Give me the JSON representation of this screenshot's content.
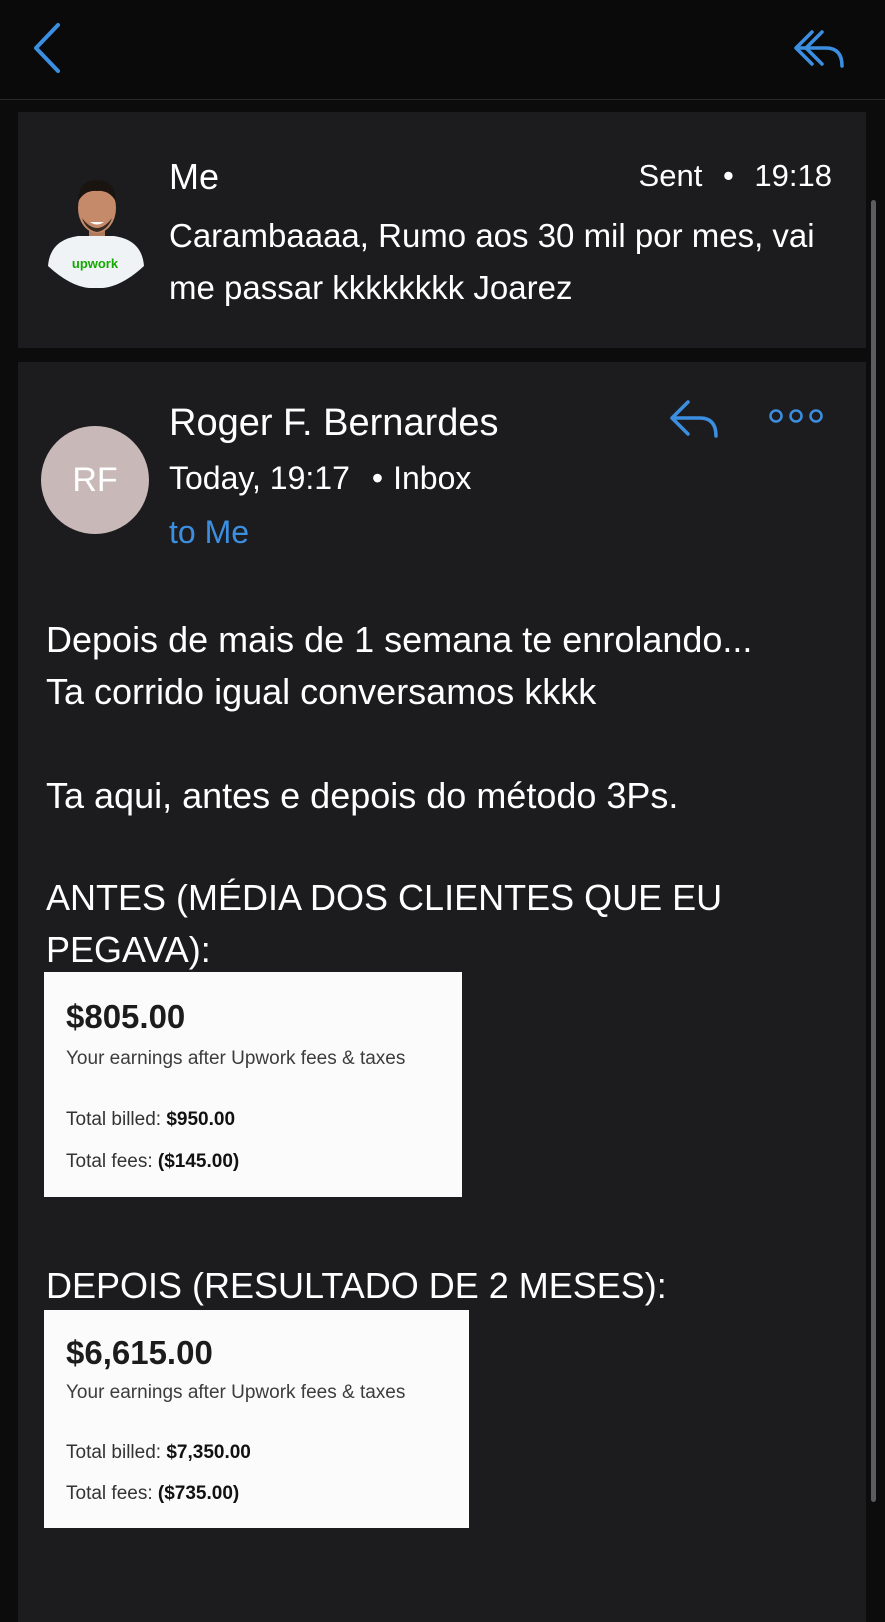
{
  "icons": {
    "back": "chevron-left-icon",
    "reply": "reply-icon",
    "more": "more-icon"
  },
  "colors": {
    "accent": "#3c8fe0",
    "avatar_bg": "#c8b8b8",
    "upwork_green": "#14a800"
  },
  "sent_message": {
    "sender": "Me",
    "status": "Sent",
    "time": "19:18",
    "preview": "Carambaaaa, Rumo aos 30 mil por mes, vai me passar kkkkkkkk Joarez",
    "avatar_logo": "upwork"
  },
  "received_message": {
    "avatar_initials": "RF",
    "sender": "Roger F. Bernardes",
    "date": "Today, 19:17",
    "folder": "Inbox",
    "recipient": "to Me",
    "body_lines": [
      "Depois de mais de 1 semana te enrolando...",
      "Ta corrido igual conversamos kkkk",
      "Ta aqui, antes e depois do método 3Ps.",
      "ANTES (MÉDIA DOS CLIENTES QUE EU",
      "PEGAVA):",
      "DEPOIS (RESULTADO DE 2 MESES):"
    ],
    "screenshot_before": {
      "amount": "$805.00",
      "subtitle": "Your earnings after Upwork fees & taxes",
      "billed_label": "Total billed:",
      "billed_value": "$950.00",
      "fees_label": "Total fees:",
      "fees_value": "($145.00)"
    },
    "screenshot_after": {
      "amount": "$6,615.00",
      "subtitle": "Your earnings after Upwork fees & taxes",
      "billed_label": "Total billed:",
      "billed_value": "$7,350.00",
      "fees_label": "Total fees:",
      "fees_value": "($735.00)"
    }
  }
}
